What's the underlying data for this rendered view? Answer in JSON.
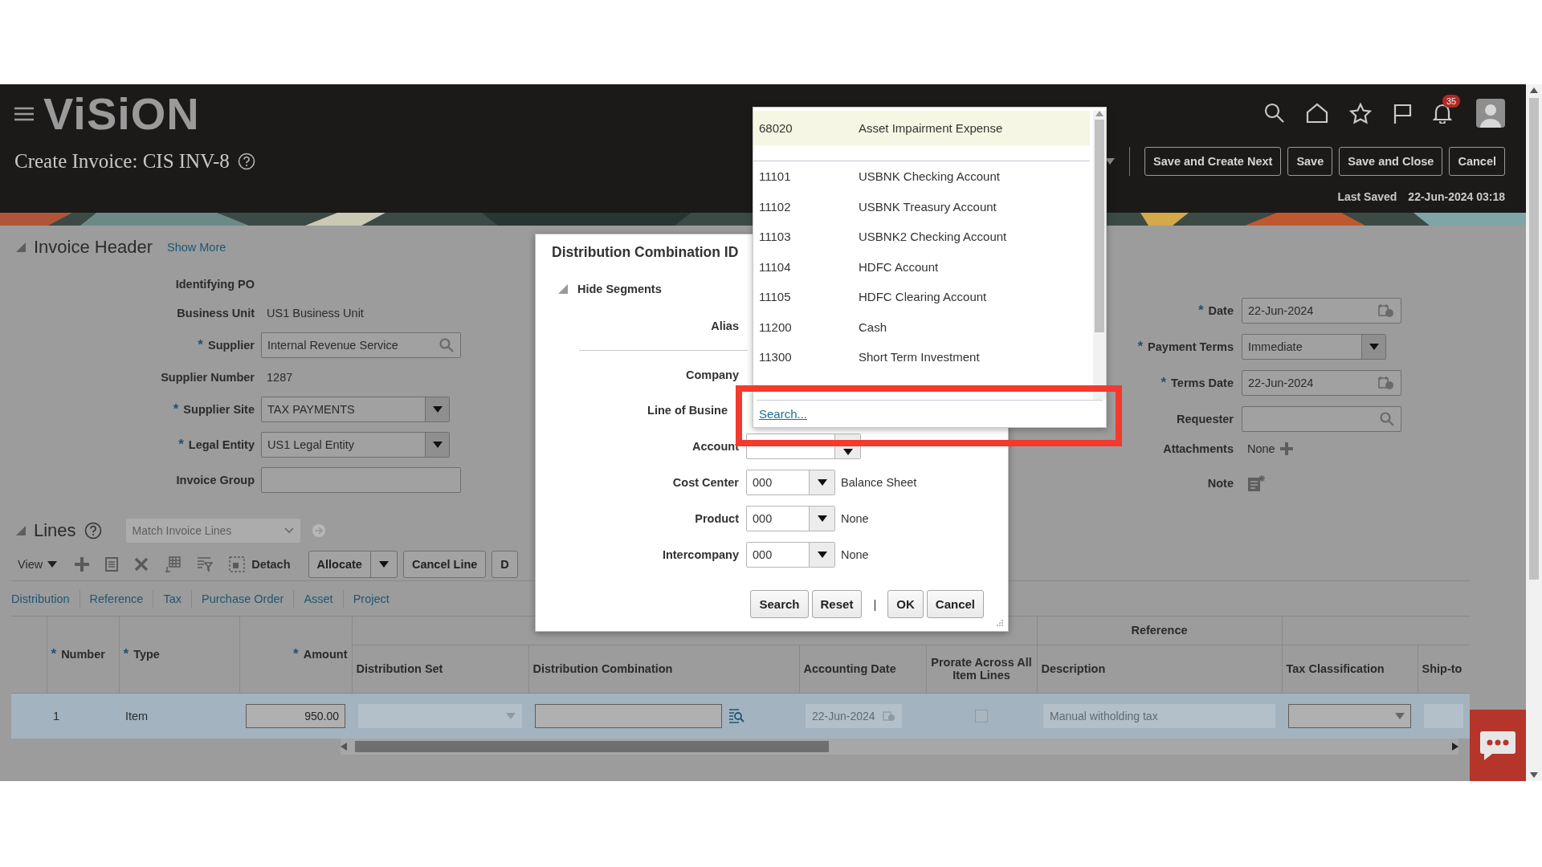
{
  "required_mark": "*",
  "header": {
    "logo": "ViSiON",
    "title": "Create Invoice: CIS INV-8",
    "notifications": "35",
    "buttons": [
      "Save and Create Next",
      "Save",
      "Save and Close",
      "Cancel"
    ],
    "last_saved_label": "Last Saved",
    "last_saved": "22-Jun-2024 03:18"
  },
  "invoice_header": {
    "title": "Invoice Header",
    "expanded": true,
    "show_more": "Show More",
    "left_fields": [
      {
        "label": "Identifying PO",
        "kind": "text",
        "required": false
      },
      {
        "label": "Business Unit",
        "kind": "text",
        "value": "US1 Business Unit",
        "required": false
      },
      {
        "label": "Supplier",
        "kind": "search",
        "value": "Internal Revenue Service",
        "required": true
      },
      {
        "label": "Supplier Number",
        "kind": "text",
        "value": "1287",
        "required": false
      },
      {
        "label": "Supplier Site",
        "kind": "select",
        "value": "TAX PAYMENTS",
        "required": true
      },
      {
        "label": "Legal Entity",
        "kind": "select",
        "value": "US1 Legal Entity",
        "required": true
      },
      {
        "label": "Invoice Group",
        "kind": "input",
        "required": false
      }
    ],
    "right_fields": [
      {
        "label": "Date",
        "kind": "date",
        "value": "22-Jun-2024",
        "required": true
      },
      {
        "label": "Payment Terms",
        "kind": "select",
        "value": "Immediate",
        "required": true
      },
      {
        "label": "Terms Date",
        "kind": "date",
        "value": "22-Jun-2024",
        "required": true
      },
      {
        "label": "Requester",
        "kind": "search",
        "required": false
      },
      {
        "label": "Attachments",
        "kind": "attach",
        "value": "None",
        "required": false
      },
      {
        "label": "Note",
        "kind": "note",
        "required": false
      }
    ]
  },
  "lines": {
    "title": "Lines",
    "expanded": true,
    "match": {
      "placeholder": "Match Invoice Lines",
      "disabled": true
    },
    "toolbar": {
      "view": "View",
      "detach": "Detach",
      "buttons": [
        {
          "label": "Allocate",
          "menu": true
        },
        {
          "label": "Cancel Line",
          "menu": false
        },
        {
          "label": "D",
          "menu": false
        }
      ]
    },
    "tabs": [
      "Distribution",
      "Reference",
      "Tax",
      "Purchase Order",
      "Asset",
      "Project"
    ],
    "table": {
      "columns": [
        {
          "label": "Number",
          "required": true
        },
        {
          "label": "Type",
          "required": true
        },
        {
          "label": "Amount",
          "required": true
        },
        {
          "label": "Distribution Set",
          "required": false
        },
        {
          "label": "Distribution Combination",
          "required": false
        },
        {
          "label": "Accounting Date",
          "required": false
        },
        {
          "label": "Prorate Across All Item Lines",
          "required": false
        },
        {
          "label": "Description",
          "required": false,
          "group": "Reference"
        },
        {
          "label": "Tax Classification",
          "required": false
        },
        {
          "label": "Ship-to",
          "required": false
        }
      ],
      "rows": [
        {
          "selected": true,
          "cells": [
            {
              "kind": "text",
              "value": "1"
            },
            {
              "kind": "text",
              "value": "Item"
            },
            {
              "kind": "input",
              "value": "950.00",
              "disabled": false
            },
            {
              "kind": "select",
              "disabled": true
            },
            {
              "kind": "lookup",
              "disabled": false
            },
            {
              "kind": "date",
              "value": "22-Jun-2024",
              "disabled": true
            },
            {
              "kind": "checkbox",
              "checked": false,
              "disabled": true
            },
            {
              "kind": "input",
              "value": "Manual witholding tax",
              "disabled": true
            },
            {
              "kind": "select",
              "disabled": false
            },
            {
              "kind": "input",
              "disabled": true
            }
          ]
        }
      ]
    }
  },
  "dialog": {
    "title": "Distribution Combination ID",
    "segments_toggle": "Hide Segments",
    "expanded": true,
    "fields": [
      {
        "label": "Alias",
        "kind": "label"
      },
      {
        "kind": "separator"
      },
      {
        "label": "Company",
        "kind": "label"
      },
      {
        "label": "Line of Busine",
        "kind": "label"
      },
      {
        "label": "Account",
        "kind": "select"
      },
      {
        "label": "Cost Center",
        "kind": "select",
        "value": "000",
        "description": "Balance Sheet"
      },
      {
        "label": "Product",
        "kind": "select",
        "value": "000",
        "description": "None"
      },
      {
        "label": "Intercompany",
        "kind": "select",
        "value": "000",
        "description": "None"
      }
    ],
    "buttons": [
      "Search",
      "Reset"
    ],
    "separator": "|",
    "actions": [
      "OK",
      "Cancel"
    ]
  },
  "account_popup": {
    "current": {
      "code": "68020",
      "name": "Asset Impairment Expense",
      "selected": true
    },
    "options": [
      {
        "code": "11101",
        "name": "USBNK Checking Account",
        "selected": false
      },
      {
        "code": "11102",
        "name": "USBNK Treasury Account",
        "selected": false
      },
      {
        "code": "11103",
        "name": "USBNK2 Checking Account",
        "selected": false
      },
      {
        "code": "11104",
        "name": "HDFC Account",
        "selected": false
      },
      {
        "code": "11105",
        "name": "HDFC Clearing Account",
        "selected": false
      },
      {
        "code": "11200",
        "name": "Cash",
        "selected": false
      },
      {
        "code": "11300",
        "name": "Short Term Investment",
        "selected": false
      }
    ],
    "search_link": "Search..."
  }
}
